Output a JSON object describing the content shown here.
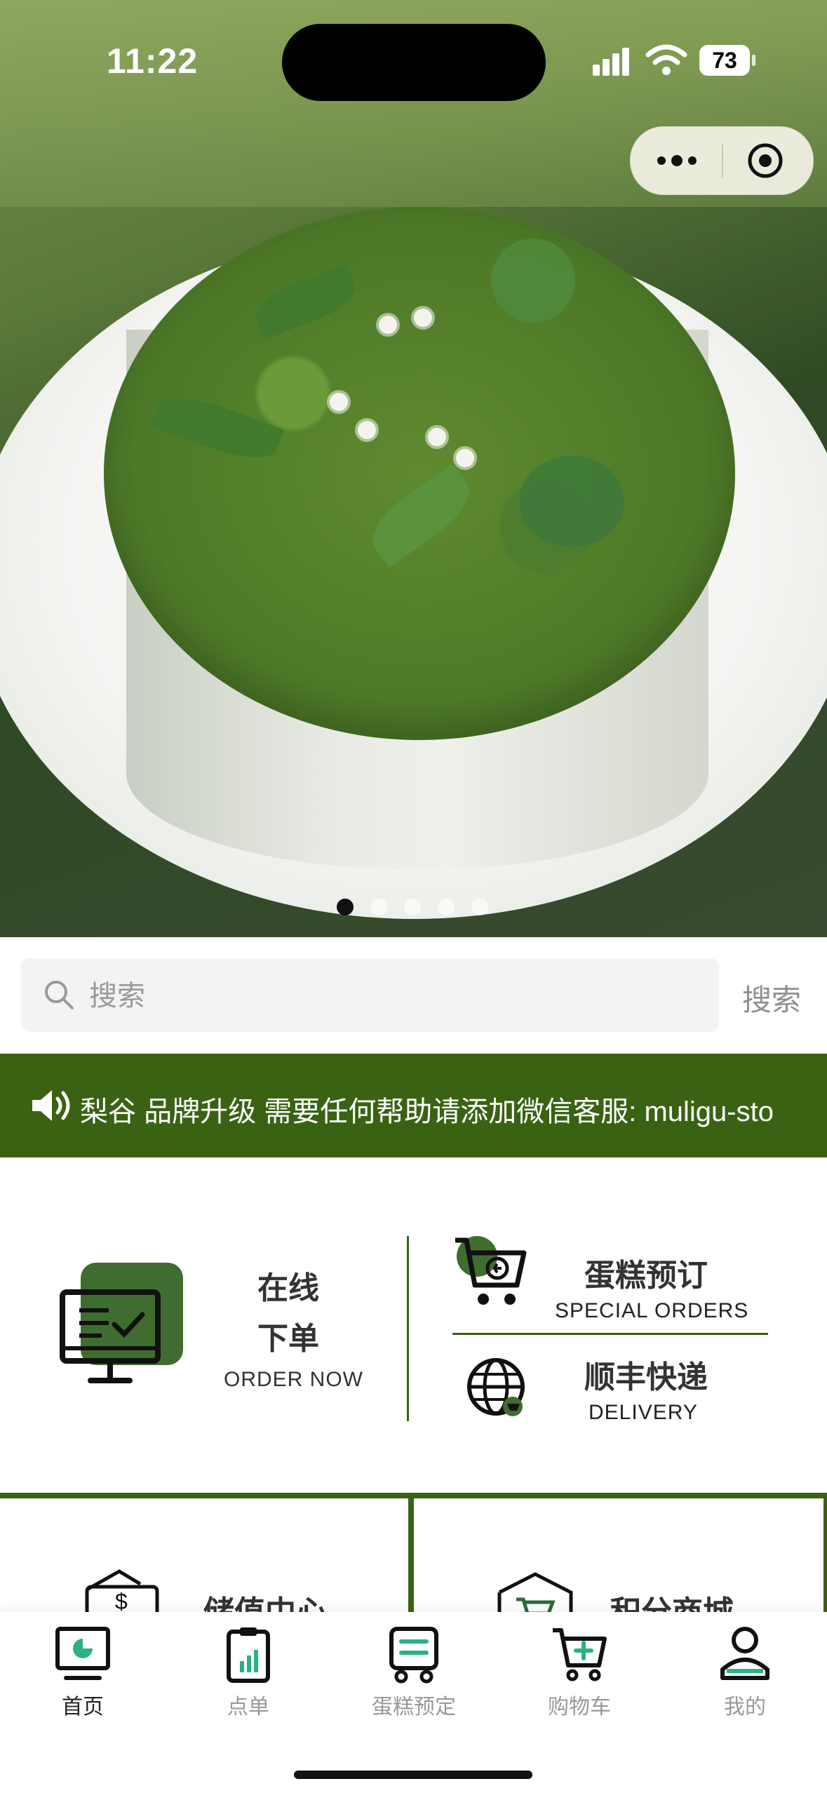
{
  "status_bar": {
    "time": "11:22",
    "battery": "73"
  },
  "hero": {
    "carousel_total": 5,
    "carousel_active_index": 0
  },
  "search": {
    "placeholder": "搜索",
    "button_label": "搜索"
  },
  "notice": {
    "text": "梨谷 品牌升级 需要任何帮助请添加微信客服: muligu-sto"
  },
  "features": {
    "online": {
      "line1": "在线",
      "line2": "下单",
      "subtitle": "ORDER NOW"
    },
    "special_orders": {
      "title": "蛋糕预订",
      "subtitle": "SPECIAL ORDERS"
    },
    "delivery": {
      "title": "顺丰快递",
      "subtitle": "DELIVERY"
    }
  },
  "grid": {
    "left_label": "储值中心",
    "right_label": "积分商城"
  },
  "tabbar": {
    "items": [
      {
        "label": "首页",
        "icon": "home-chart-icon",
        "active": true
      },
      {
        "label": "点单",
        "icon": "clipboard-chart-icon",
        "active": false
      },
      {
        "label": "蛋糕预定",
        "icon": "cake-cart-icon",
        "active": false
      },
      {
        "label": "购物车",
        "icon": "cart-plus-icon",
        "active": false
      },
      {
        "label": "我的",
        "icon": "person-icon",
        "active": false
      }
    ]
  },
  "colors": {
    "brand_green": "#3a6213",
    "accent_teal": "#2bb088",
    "inactive_tab": "#999999"
  }
}
